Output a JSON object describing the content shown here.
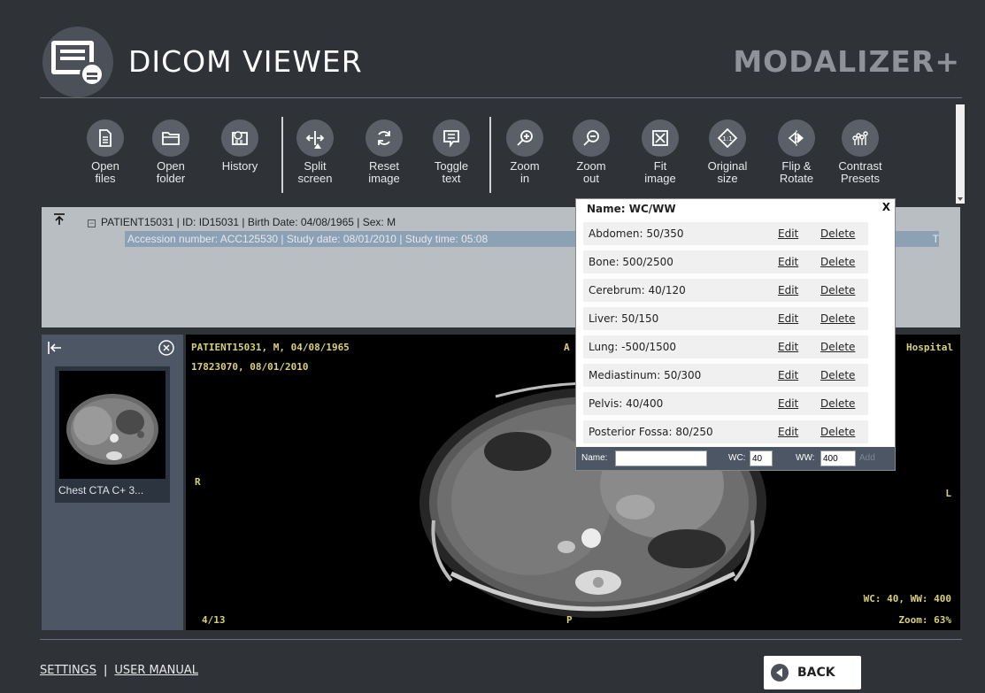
{
  "header": {
    "title": "DICOM VIEWER",
    "brand": "MODALIZER+"
  },
  "toolbar": {
    "tools": [
      {
        "id": "open-files",
        "label1": "Open",
        "label2": "files",
        "icon": "file-icon"
      },
      {
        "id": "open-folder",
        "label1": "Open",
        "label2": "folder",
        "icon": "folder-icon"
      },
      {
        "id": "history",
        "label1": "History",
        "label2": "",
        "icon": "history-icon"
      },
      {
        "id": "split-screen",
        "label1": "Split",
        "label2": "screen",
        "icon": "split-icon"
      },
      {
        "id": "reset-image",
        "label1": "Reset",
        "label2": "image",
        "icon": "reset-icon"
      },
      {
        "id": "toggle-text",
        "label1": "Toggle",
        "label2": "text",
        "icon": "text-icon"
      },
      {
        "id": "zoom-in",
        "label1": "Zoom",
        "label2": "in",
        "icon": "zoom-in-icon"
      },
      {
        "id": "zoom-out",
        "label1": "Zoom",
        "label2": "out",
        "icon": "zoom-out-icon"
      },
      {
        "id": "fit-image",
        "label1": "Fit",
        "label2": "image",
        "icon": "fit-icon"
      },
      {
        "id": "original-size",
        "label1": "Original",
        "label2": "size",
        "icon": "original-size-icon"
      },
      {
        "id": "flip-rotate",
        "label1": "Flip &",
        "label2": "Rotate",
        "icon": "flip-icon"
      },
      {
        "id": "contrast-presets",
        "label1": "Contrast",
        "label2": "Presets",
        "icon": "contrast-icon"
      }
    ]
  },
  "study": {
    "patient_line": "PATIENT15031 | ID: ID15031 | Birth Date: 04/08/1965 | Sex: M",
    "study_line": "Accession number: ACC125530 | Study date: 08/01/2010 | Study time: 05:08",
    "study_line_tail": "T"
  },
  "thumbnails": {
    "items": [
      {
        "label": "Chest  CTA C+ 3..."
      }
    ]
  },
  "viewer": {
    "top_left_1": "PATIENT15031, M, 04/08/1965",
    "top_left_2": "17823070, 08/01/2010",
    "top_center": "A",
    "top_right": "Hospital",
    "left_marker": "R",
    "right_marker": "L",
    "bottom_center": "P",
    "bottom_left": "4/13",
    "bottom_right_1": "WC: 40, WW: 400",
    "bottom_right_2": "Zoom: 63%"
  },
  "presets": {
    "header": "Name: WC/WW",
    "close": "X",
    "edit_label": "Edit",
    "delete_label": "Delete",
    "items": [
      {
        "name": "Abdomen: 50/350"
      },
      {
        "name": "Bone: 500/2500"
      },
      {
        "name": "Cerebrum: 40/120"
      },
      {
        "name": "Liver: 50/150"
      },
      {
        "name": "Lung: -500/1500"
      },
      {
        "name": "Mediastinum: 50/300"
      },
      {
        "name": "Pelvis: 40/400"
      },
      {
        "name": "Posterior Fossa: 80/250"
      }
    ],
    "add": {
      "name_label": "Name:",
      "name_value": "",
      "wc_label": "WC:",
      "wc_value": "40",
      "ww_label": "WW:",
      "ww_value": "400",
      "add_label": "Add"
    }
  },
  "footer": {
    "settings": "SETTINGS",
    "separator": "|",
    "manual": "USER MANUAL",
    "back": "BACK"
  },
  "colors": {
    "background": "#2f3338",
    "panel": "#4c5665",
    "study_panel": "#b9bec3",
    "selection": "#8da1b5",
    "overlay_text": "#d9d07a"
  }
}
